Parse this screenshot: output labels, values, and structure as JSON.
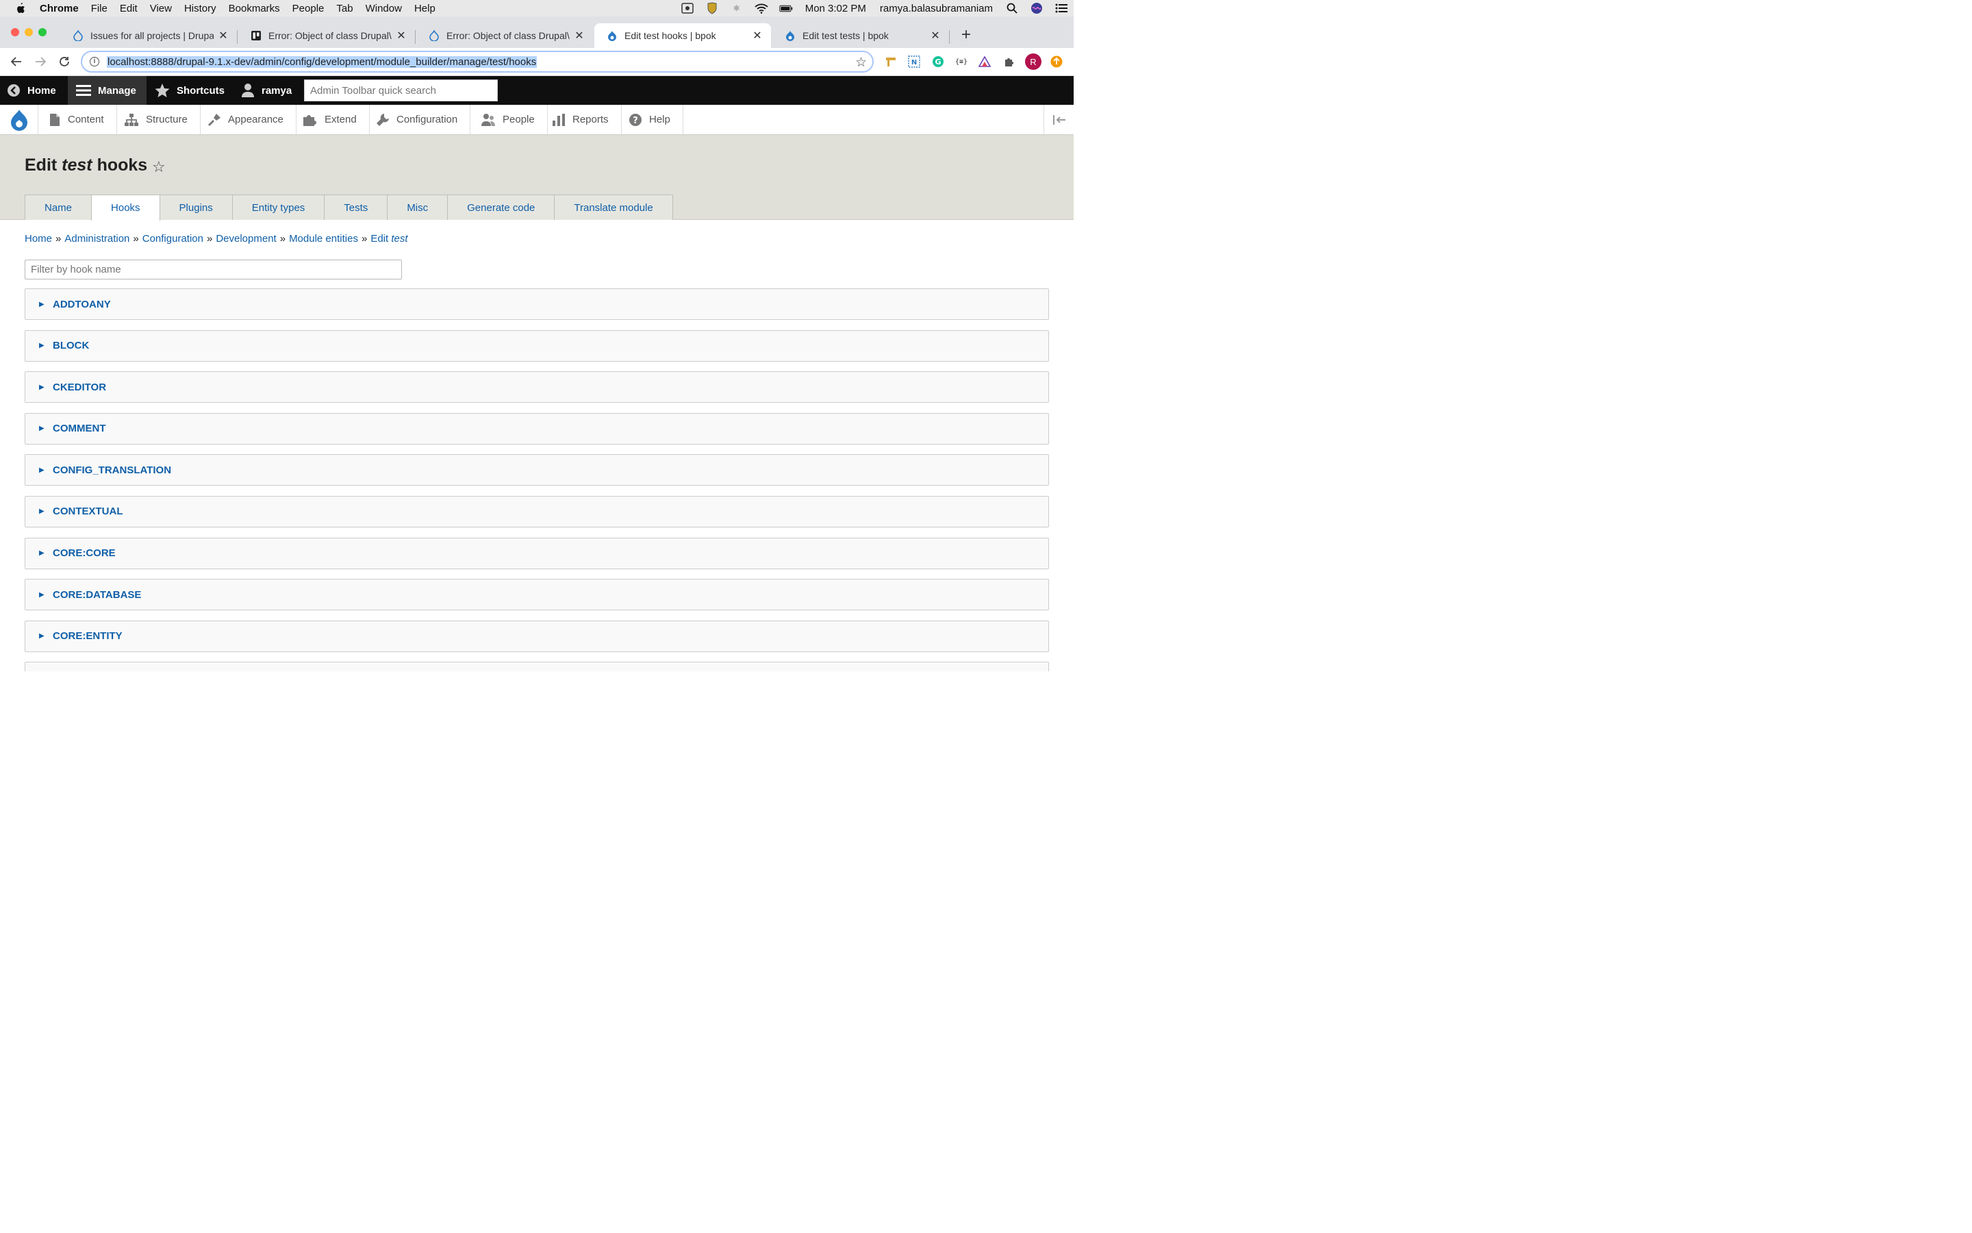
{
  "mac_menubar": {
    "app": "Chrome",
    "menus": [
      "File",
      "Edit",
      "View",
      "History",
      "Bookmarks",
      "People",
      "Tab",
      "Window",
      "Help"
    ],
    "clock": "Mon 3:02 PM",
    "user": "ramya.balasubramaniam"
  },
  "browser": {
    "tabs": [
      {
        "title": "Issues for all projects | Drupal.o",
        "icon": "drupal-icon"
      },
      {
        "title": "Error: Object of class Drupal\\Co",
        "icon": "trello-icon"
      },
      {
        "title": "Error: Object of class Drupal\\Co",
        "icon": "drupal-icon"
      },
      {
        "title": "Edit test hooks | bpok",
        "icon": "drupal-icon",
        "active": true
      },
      {
        "title": "Edit test tests | bpok",
        "icon": "drupal-icon"
      }
    ],
    "url": "localhost:8888/drupal-9.1.x-dev/admin/config/development/module_builder/manage/test/hooks",
    "profile_initial": "R"
  },
  "admin_toolbar": {
    "home": "Home",
    "manage": "Manage",
    "shortcuts": "Shortcuts",
    "user": "ramya",
    "search_placeholder": "Admin Toolbar quick search"
  },
  "admin_tray": {
    "items": [
      "Content",
      "Structure",
      "Appearance",
      "Extend",
      "Configuration",
      "People",
      "Reports",
      "Help"
    ]
  },
  "page": {
    "title_prefix": "Edit",
    "title_em": "test",
    "title_suffix": "hooks",
    "tabs": [
      "Name",
      "Hooks",
      "Plugins",
      "Entity types",
      "Tests",
      "Misc",
      "Generate code",
      "Translate module"
    ],
    "active_tab": "Hooks",
    "breadcrumb": [
      "Home",
      "Administration",
      "Configuration",
      "Development",
      "Module entities"
    ],
    "breadcrumb_last_prefix": "Edit",
    "breadcrumb_last_em": "test",
    "filter_placeholder": "Filter by hook name",
    "hook_groups": [
      "ADDTOANY",
      "BLOCK",
      "CKEDITOR",
      "COMMENT",
      "CONFIG_TRANSLATION",
      "CONTEXTUAL",
      "CORE:CORE",
      "CORE:DATABASE",
      "CORE:ENTITY"
    ]
  },
  "colors": {
    "link": "#0f5fa8",
    "admin_bar": "#0f0f0f",
    "header_bg": "#e0e0d8",
    "url_highlight": "#b3d4fc"
  }
}
